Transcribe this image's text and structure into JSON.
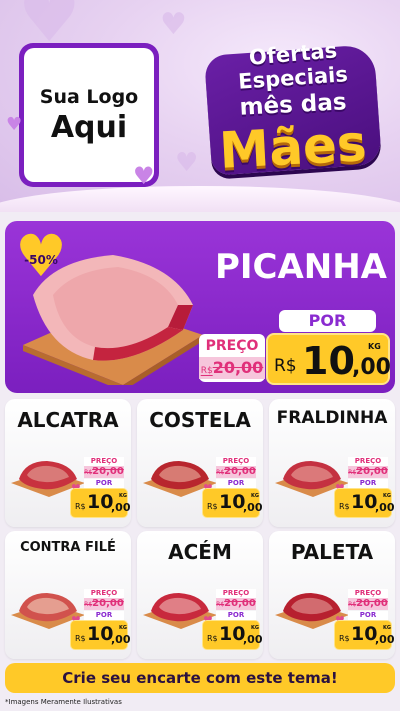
{
  "brand": {
    "logo_line1": "Sua Logo",
    "logo_line2": "Aqui"
  },
  "title": {
    "line1": "Ofertas",
    "line2": "Especiais",
    "line3": "mês das",
    "line4": "Mães"
  },
  "featured": {
    "name": "PICANHA",
    "discount_badge": "-50%",
    "preco_label": "PREÇO",
    "old_price_currency": "R$",
    "old_price": "20,00",
    "por_label": "POR",
    "currency": "R$",
    "price_integer": "10",
    "price_decimal": ",00",
    "unit": "KG"
  },
  "products": [
    {
      "name": "ALCATRA",
      "preco_label": "PREÇO",
      "old_currency": "R$",
      "old_price": "20,00",
      "por_label": "POR",
      "currency": "R$",
      "price_integer": "10",
      "price_decimal": ",00",
      "unit": "KG"
    },
    {
      "name": "COSTELA",
      "preco_label": "PREÇO",
      "old_currency": "R$",
      "old_price": "20,00",
      "por_label": "POR",
      "currency": "R$",
      "price_integer": "10",
      "price_decimal": ",00",
      "unit": "KG"
    },
    {
      "name": "FRALDINHA",
      "preco_label": "PREÇO",
      "old_currency": "R$",
      "old_price": "20,00",
      "por_label": "POR",
      "currency": "R$",
      "price_integer": "10",
      "price_decimal": ",00",
      "unit": "KG"
    },
    {
      "name": "CONTRA FILÉ",
      "preco_label": "PREÇO",
      "old_currency": "R$",
      "old_price": "20,00",
      "por_label": "POR",
      "currency": "R$",
      "price_integer": "10",
      "price_decimal": ",00",
      "unit": "KG"
    },
    {
      "name": "ACÉM",
      "preco_label": "PREÇO",
      "old_currency": "R$",
      "old_price": "20,00",
      "por_label": "POR",
      "currency": "R$",
      "price_integer": "10",
      "price_decimal": ",00",
      "unit": "KG"
    },
    {
      "name": "PALETA",
      "preco_label": "PREÇO",
      "old_currency": "R$",
      "old_price": "20,00",
      "por_label": "POR",
      "currency": "R$",
      "price_integer": "10",
      "price_decimal": ",00",
      "unit": "KG"
    }
  ],
  "footer": {
    "cta": "Crie seu encarte com este tema!",
    "disclaimer": "*Imagens Meramente Ilustrativas"
  },
  "colors": {
    "purple": "#7b1fbf",
    "yellow": "#ffc928",
    "pink": "#e0307a",
    "lavender": "#e7d2f1"
  },
  "icons": [
    "heart-icon",
    "meat-image",
    "discount-heart-badge"
  ]
}
